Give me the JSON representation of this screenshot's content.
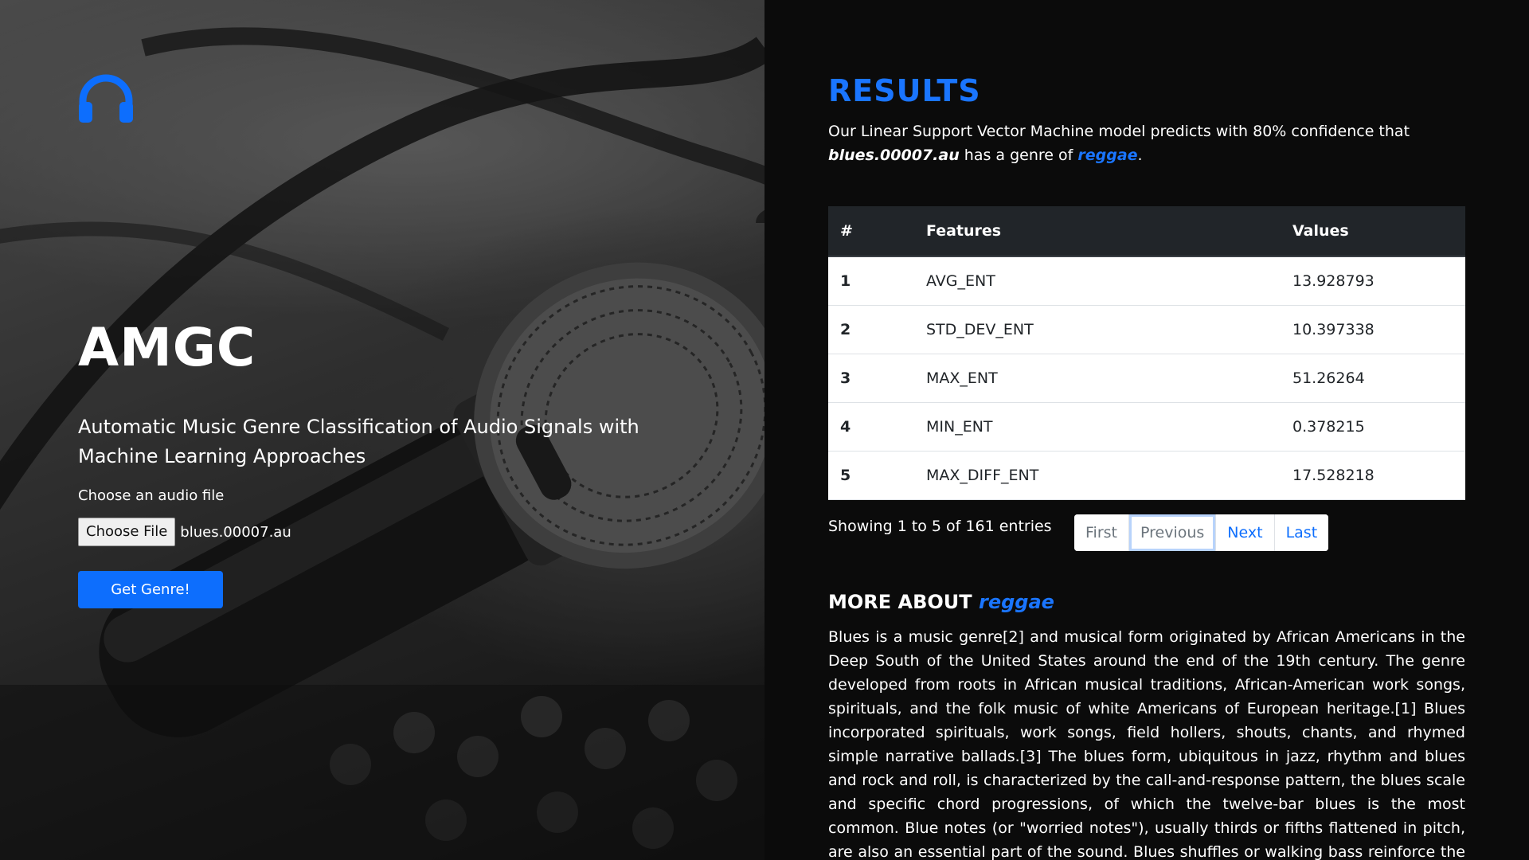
{
  "brand": {
    "logo_icon": "headphones-icon",
    "accent_color": "#1a75ff",
    "title": "AMGC",
    "subtitle": "Automatic Music Genre Classification of Audio Signals with Machine Learning Approaches"
  },
  "upload": {
    "label": "Choose an audio file",
    "choose_button": "Choose File",
    "file_name": "blues.00007.au",
    "submit_button": "Get Genre!"
  },
  "results": {
    "title": "RESULTS",
    "prediction_prefix": "Our Linear Support Vector Machine model predicts with 80% confidence that",
    "file_name": "blues.00007.au",
    "prediction_middle": "has a genre of",
    "genre": "reggae",
    "prediction_suffix": "."
  },
  "table": {
    "headers": [
      "#",
      "Features",
      "Values"
    ],
    "rows": [
      {
        "num": "1",
        "feature": "AVG_ENT",
        "value": "13.928793"
      },
      {
        "num": "2",
        "feature": "STD_DEV_ENT",
        "value": "10.397338"
      },
      {
        "num": "3",
        "feature": "MAX_ENT",
        "value": "51.26264"
      },
      {
        "num": "4",
        "feature": "MIN_ENT",
        "value": "0.378215"
      },
      {
        "num": "5",
        "feature": "MAX_DIFF_ENT",
        "value": "17.528218"
      }
    ],
    "info": "Showing 1 to 5 of 161 entries",
    "pagination": {
      "first": "First",
      "previous": "Previous",
      "next": "Next",
      "last": "Last"
    }
  },
  "more": {
    "title_prefix": "MORE ABOUT",
    "genre": "reggae",
    "text": "Blues is a music genre[2] and musical form originated by African Americans in the Deep South of the United States around the end of the 19th century. The genre developed from roots in African musical traditions, African-American work songs, spirituals, and the folk music of white Americans of European heritage.[1] Blues incorporated spirituals, work songs, field hollers, shouts, chants, and rhymed simple narrative ballads.[3] The blues form, ubiquitous in jazz, rhythm and blues and rock and roll, is characterized by the call-and-response pattern, the blues scale and specific chord progressions, of which the twelve-bar blues is the most common. Blue notes (or \"worried notes\"), usually thirds or fifths flattened in pitch, are also an essential part of the sound. Blues shuffles or walking bass reinforce the trance-like rhythm and form a repetitive effect known as the groove."
  }
}
